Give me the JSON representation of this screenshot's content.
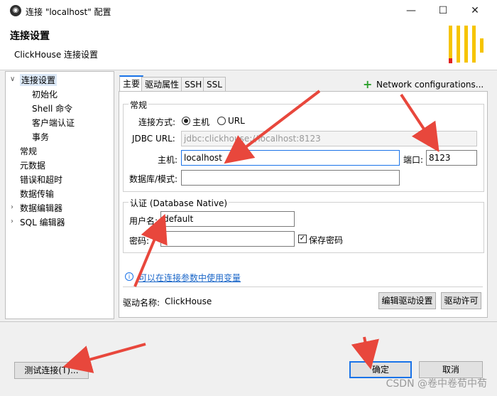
{
  "window": {
    "title": "连接 \"localhost\" 配置",
    "header_title": "连接设置",
    "header_subtitle": "ClickHouse 连接设置"
  },
  "colors": {
    "accent": "#1a73e8",
    "logo_yellow": "#f6c400",
    "logo_red": "#e02020",
    "arrow_red": "#e8473c"
  },
  "nav": {
    "items": [
      {
        "label": "连接设置"
      },
      {
        "label": "初始化"
      },
      {
        "label": "Shell 命令"
      },
      {
        "label": "客户端认证"
      },
      {
        "label": "事务"
      },
      {
        "label": "常规"
      },
      {
        "label": "元数据"
      },
      {
        "label": "错误和超时"
      },
      {
        "label": "数据传输"
      },
      {
        "label": "数据编辑器"
      },
      {
        "label": "SQL 编辑器"
      }
    ]
  },
  "tabs": [
    {
      "label": "主要"
    },
    {
      "label": "驱动属性"
    },
    {
      "label": "SSH"
    },
    {
      "label": "SSL"
    }
  ],
  "network_config_label": "Network configurations...",
  "general": {
    "group_label": "常规",
    "connect_mode_label": "连接方式:",
    "radio_host": "主机",
    "radio_url": "URL",
    "jdbc_label": "JDBC URL:",
    "jdbc_value": "jdbc:clickhouse://localhost:8123",
    "host_label": "主机:",
    "host_value": "localhost",
    "port_label": "端口:",
    "port_value": "8123",
    "db_label": "数据库/模式:",
    "db_value": ""
  },
  "auth": {
    "group_label": "认证 (Database Native)",
    "user_label": "用户名:",
    "user_value": "default",
    "password_label": "密码:",
    "password_value": "",
    "save_password_label": "保存密码"
  },
  "variables_link": "可以在连接参数中使用变量",
  "driver": {
    "name_label": "驱动名称:",
    "name_value": "ClickHouse",
    "edit_button": "编辑驱动设置",
    "license_button": "驱动许可"
  },
  "footer": {
    "test_button": "测试连接(T)...",
    "ok_button": "确定",
    "cancel_button": "取消"
  },
  "watermark": "CSDN @卷中卷荀中荀"
}
